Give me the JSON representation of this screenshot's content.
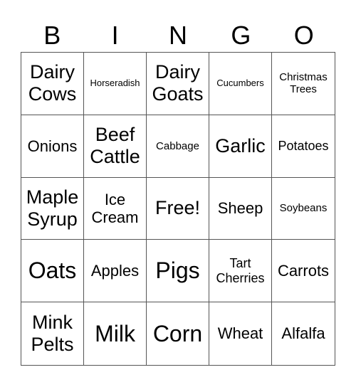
{
  "header": [
    "B",
    "I",
    "N",
    "G",
    "O"
  ],
  "cells": [
    {
      "text": "Dairy Cows",
      "size": "s-l"
    },
    {
      "text": "Horseradish",
      "size": "s-xxs"
    },
    {
      "text": "Dairy Goats",
      "size": "s-l"
    },
    {
      "text": "Cucumbers",
      "size": "s-xxs"
    },
    {
      "text": "Christmas Trees",
      "size": "s-xs"
    },
    {
      "text": "Onions",
      "size": "s-m"
    },
    {
      "text": "Beef Cattle",
      "size": "s-l"
    },
    {
      "text": "Cabbage",
      "size": "s-xs"
    },
    {
      "text": "Garlic",
      "size": "s-l"
    },
    {
      "text": "Potatoes",
      "size": "s-s"
    },
    {
      "text": "Maple Syrup",
      "size": "s-l"
    },
    {
      "text": "Ice Cream",
      "size": "s-m"
    },
    {
      "text": "Free!",
      "size": "s-l"
    },
    {
      "text": "Sheep",
      "size": "s-m"
    },
    {
      "text": "Soybeans",
      "size": "s-xs"
    },
    {
      "text": "Oats",
      "size": "s-xl"
    },
    {
      "text": "Apples",
      "size": "s-m"
    },
    {
      "text": "Pigs",
      "size": "s-xl"
    },
    {
      "text": "Tart Cherries",
      "size": "s-s"
    },
    {
      "text": "Carrots",
      "size": "s-m"
    },
    {
      "text": "Mink Pelts",
      "size": "s-l"
    },
    {
      "text": "Milk",
      "size": "s-xl"
    },
    {
      "text": "Corn",
      "size": "s-xl"
    },
    {
      "text": "Wheat",
      "size": "s-m"
    },
    {
      "text": "Alfalfa",
      "size": "s-m"
    }
  ]
}
